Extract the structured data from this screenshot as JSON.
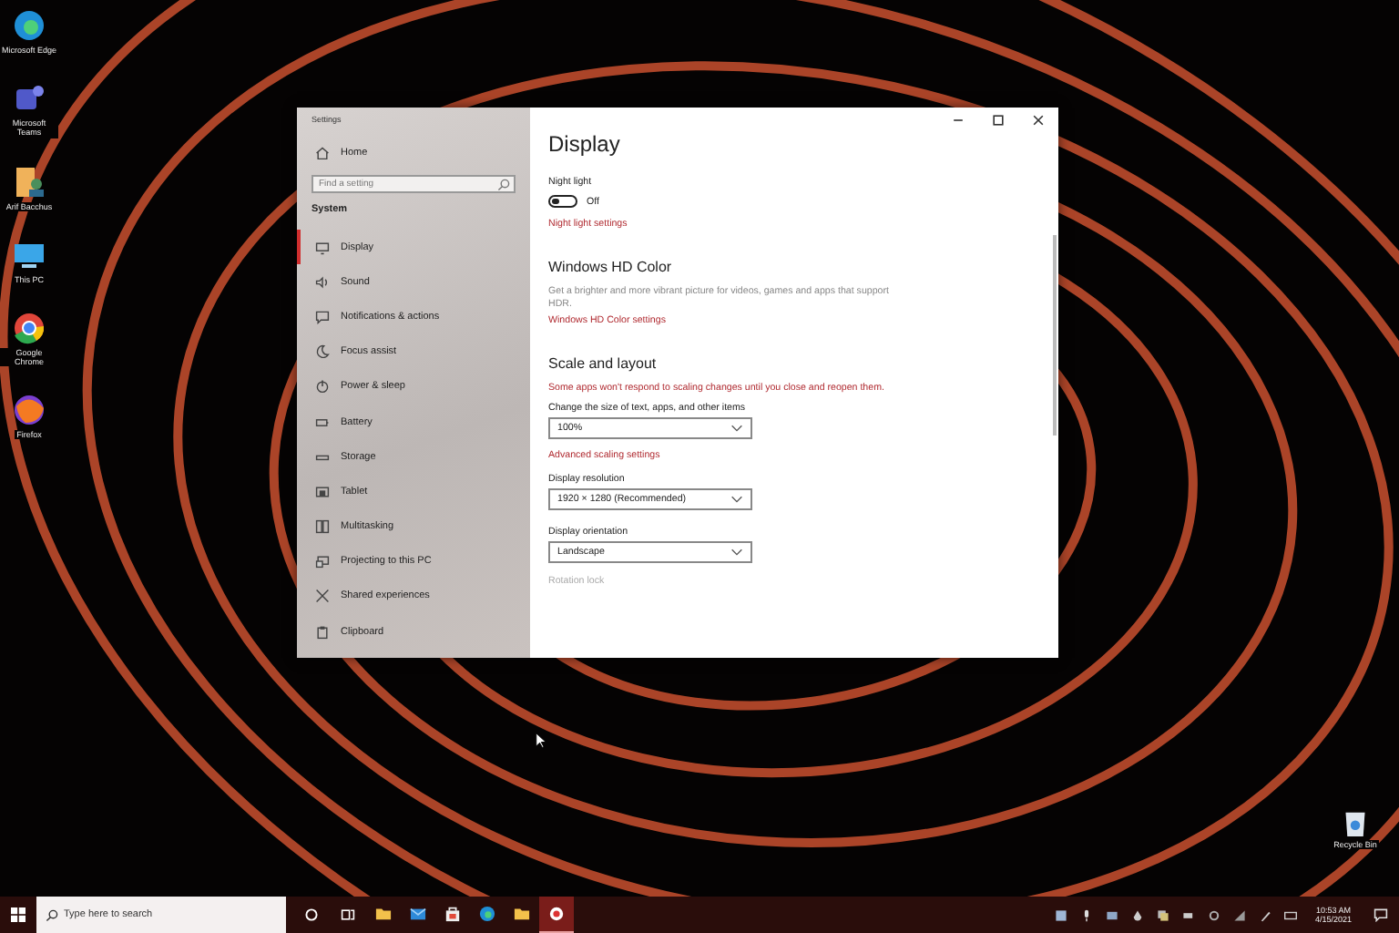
{
  "desktop_icons": [
    {
      "kind": "swirl",
      "label": "Microsoft Edge"
    },
    {
      "kind": "people",
      "label": "Microsoft Teams"
    },
    {
      "kind": "user",
      "label": "Arif Bacchus"
    },
    {
      "kind": "monitor",
      "label": "This PC"
    },
    {
      "kind": "ring",
      "label": "Google Chrome"
    },
    {
      "kind": "fox",
      "label": "Firefox"
    }
  ],
  "recycle_bin": {
    "label": "Recycle Bin"
  },
  "window": {
    "title": "Settings"
  },
  "sidebar": {
    "home": "Home",
    "search": {
      "placeholder": "Find a setting"
    },
    "section": "System",
    "items": [
      {
        "kind": "monitor",
        "label": "Display",
        "selected": true
      },
      {
        "kind": "speaker",
        "label": "Sound",
        "selected": false
      },
      {
        "kind": "message",
        "label": "Notifications & actions",
        "selected": false
      },
      {
        "kind": "moon",
        "label": "Focus assist",
        "selected": false
      },
      {
        "kind": "power",
        "label": "Power & sleep",
        "selected": false
      },
      {
        "kind": "battery",
        "label": "Battery",
        "selected": false
      },
      {
        "kind": "drive",
        "label": "Storage",
        "selected": false
      },
      {
        "kind": "tablet",
        "label": "Tablet",
        "selected": false
      },
      {
        "kind": "windows",
        "label": "Multitasking",
        "selected": false
      },
      {
        "kind": "project",
        "label": "Projecting to this PC",
        "selected": false
      },
      {
        "kind": "shared",
        "label": "Shared experiences",
        "selected": false
      },
      {
        "kind": "clipboard",
        "label": "Clipboard",
        "selected": false
      }
    ]
  },
  "content": {
    "title": "Display",
    "blocks": [
      {
        "kind": "label",
        "text": "Night light"
      },
      {
        "kind": "toggle",
        "on": false,
        "text": "Off"
      },
      {
        "kind": "link",
        "text": "Night light settings"
      },
      {
        "kind": "heading",
        "text": "Windows HD Color"
      },
      {
        "kind": "note",
        "text": "Get a brighter and more vibrant picture for videos, games and apps that support HDR."
      },
      {
        "kind": "link",
        "text": "Windows HD Color settings"
      },
      {
        "kind": "heading",
        "text": "Scale and layout"
      },
      {
        "kind": "warning",
        "text": "Some apps won't respond to scaling changes until you close and reopen them."
      },
      {
        "kind": "label",
        "text": "Change the size of text, apps, and other items"
      },
      {
        "kind": "dropdown",
        "text": "100%"
      },
      {
        "kind": "link",
        "text": "Advanced scaling settings"
      },
      {
        "kind": "label",
        "text": "Display resolution"
      },
      {
        "kind": "dropdown",
        "text": "1920 × 1280 (Recommended)"
      },
      {
        "kind": "label",
        "text": "Display orientation"
      },
      {
        "kind": "dropdown",
        "text": "Landscape"
      },
      {
        "kind": "disabled",
        "text": "Rotation lock"
      }
    ]
  },
  "taskbar": {
    "search": {
      "placeholder": "Type here to search"
    },
    "apps": [
      {
        "kind": "folder",
        "selected": false
      },
      {
        "kind": "mail",
        "selected": false
      },
      {
        "kind": "bag",
        "selected": false
      },
      {
        "kind": "swirl",
        "selected": false
      },
      {
        "kind": "folder",
        "selected": false
      },
      {
        "kind": "record",
        "selected": true
      }
    ],
    "time": "10:53 AM",
    "date": "4/15/2021"
  }
}
